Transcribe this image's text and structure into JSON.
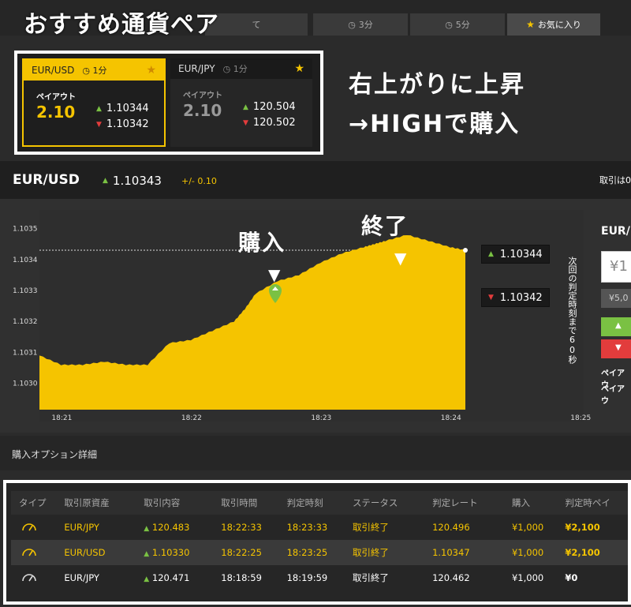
{
  "overlay": {
    "title": "おすすめ通貨ペア",
    "hint_line1": "右上がりに上昇",
    "hint_line2": "→HIGHで購入",
    "buy_label": "購入",
    "end_label": "終了"
  },
  "top_tabs": [
    {
      "label": "て",
      "active": false
    },
    {
      "label": "3分",
      "icon": "clock-icon",
      "active": false
    },
    {
      "label": "5分",
      "icon": "clock-icon",
      "active": false
    },
    {
      "label": "お気に入り",
      "icon": "star-icon",
      "active": true
    }
  ],
  "pair_cards": [
    {
      "pair": "EUR/USD",
      "duration": "1分",
      "payout_label": "ペイアウト",
      "payout": "2.10",
      "high_rate": "1.10344",
      "low_rate": "1.10342"
    },
    {
      "pair": "EUR/JPY",
      "duration": "1分",
      "payout_label": "ペイアウト",
      "payout": "2.10",
      "high_rate": "120.504",
      "low_rate": "120.502"
    }
  ],
  "asset": {
    "name": "EUR/USD",
    "rate": "1.10343",
    "change": "+/- 0.10",
    "trade_note": "取引は0"
  },
  "chart": {
    "y_ticks": [
      "1.1035",
      "1.1034",
      "1.1033",
      "1.1032",
      "1.1031",
      "1.1030"
    ],
    "x_ticks": [
      "18:21",
      "18:22",
      "18:23",
      "18:24",
      "18:25"
    ],
    "high_tag": "1.10344",
    "low_tag": "1.10342",
    "next_judgement": "次回の判定時刻まで60秒"
  },
  "chart_data": {
    "type": "area",
    "title": "",
    "xlabel": "",
    "ylabel": "",
    "x": [
      "18:20:50",
      "18:21:00",
      "18:21:10",
      "18:21:20",
      "18:21:30",
      "18:21:40",
      "18:21:50",
      "18:22:00",
      "18:22:10",
      "18:22:20",
      "18:22:25",
      "18:22:30",
      "18:22:40",
      "18:22:50",
      "18:23:00",
      "18:23:10",
      "18:23:20",
      "18:23:25",
      "18:23:30",
      "18:23:40",
      "18:23:50",
      "18:24:00",
      "18:24:07"
    ],
    "values": [
      1.10309,
      1.10306,
      1.10306,
      1.10307,
      1.10306,
      1.10306,
      1.10313,
      1.10314,
      1.10317,
      1.1032,
      1.10324,
      1.10329,
      1.10333,
      1.10335,
      1.10339,
      1.10342,
      1.10344,
      1.10345,
      1.10346,
      1.10348,
      1.10346,
      1.10344,
      1.10343
    ],
    "ylim": [
      1.10292,
      1.10356
    ],
    "grid": false,
    "color": "#f5c400"
  },
  "right_panel": {
    "pair": "EUR/",
    "amount_input": "¥1",
    "amount_option": "¥5,0",
    "high_label": "▲",
    "low_label": "▼",
    "payout_line1": "ペイアウ",
    "payout_line2": "ペイアウ"
  },
  "details": {
    "title": "購入オプション詳細",
    "columns": [
      "タイプ",
      "取引原資産",
      "取引内容",
      "取引時間",
      "判定時刻",
      "ステータス",
      "判定レート",
      "購入",
      "判定時ペイ"
    ],
    "rows": [
      {
        "asset": "EUR/JPY",
        "direction": "up",
        "rate": "120.483",
        "time": "18:22:33",
        "judge_time": "18:23:33",
        "status": "取引終了",
        "judge_rate": "120.496",
        "amount": "¥1,000",
        "payout": "¥2,100",
        "highlight": true
      },
      {
        "asset": "EUR/USD",
        "direction": "up",
        "rate": "1.10330",
        "time": "18:22:25",
        "judge_time": "18:23:25",
        "status": "取引終了",
        "judge_rate": "1.10347",
        "amount": "¥1,000",
        "payout": "¥2,100",
        "highlight": true
      },
      {
        "asset": "EUR/JPY",
        "direction": "up",
        "rate": "120.471",
        "time": "18:18:59",
        "judge_time": "18:19:59",
        "status": "取引終了",
        "judge_rate": "120.462",
        "amount": "¥1,000",
        "payout": "¥0",
        "highlight": false
      }
    ]
  },
  "colors": {
    "accent": "#f5c400",
    "up": "#7ac143",
    "down": "#e23c3c"
  }
}
